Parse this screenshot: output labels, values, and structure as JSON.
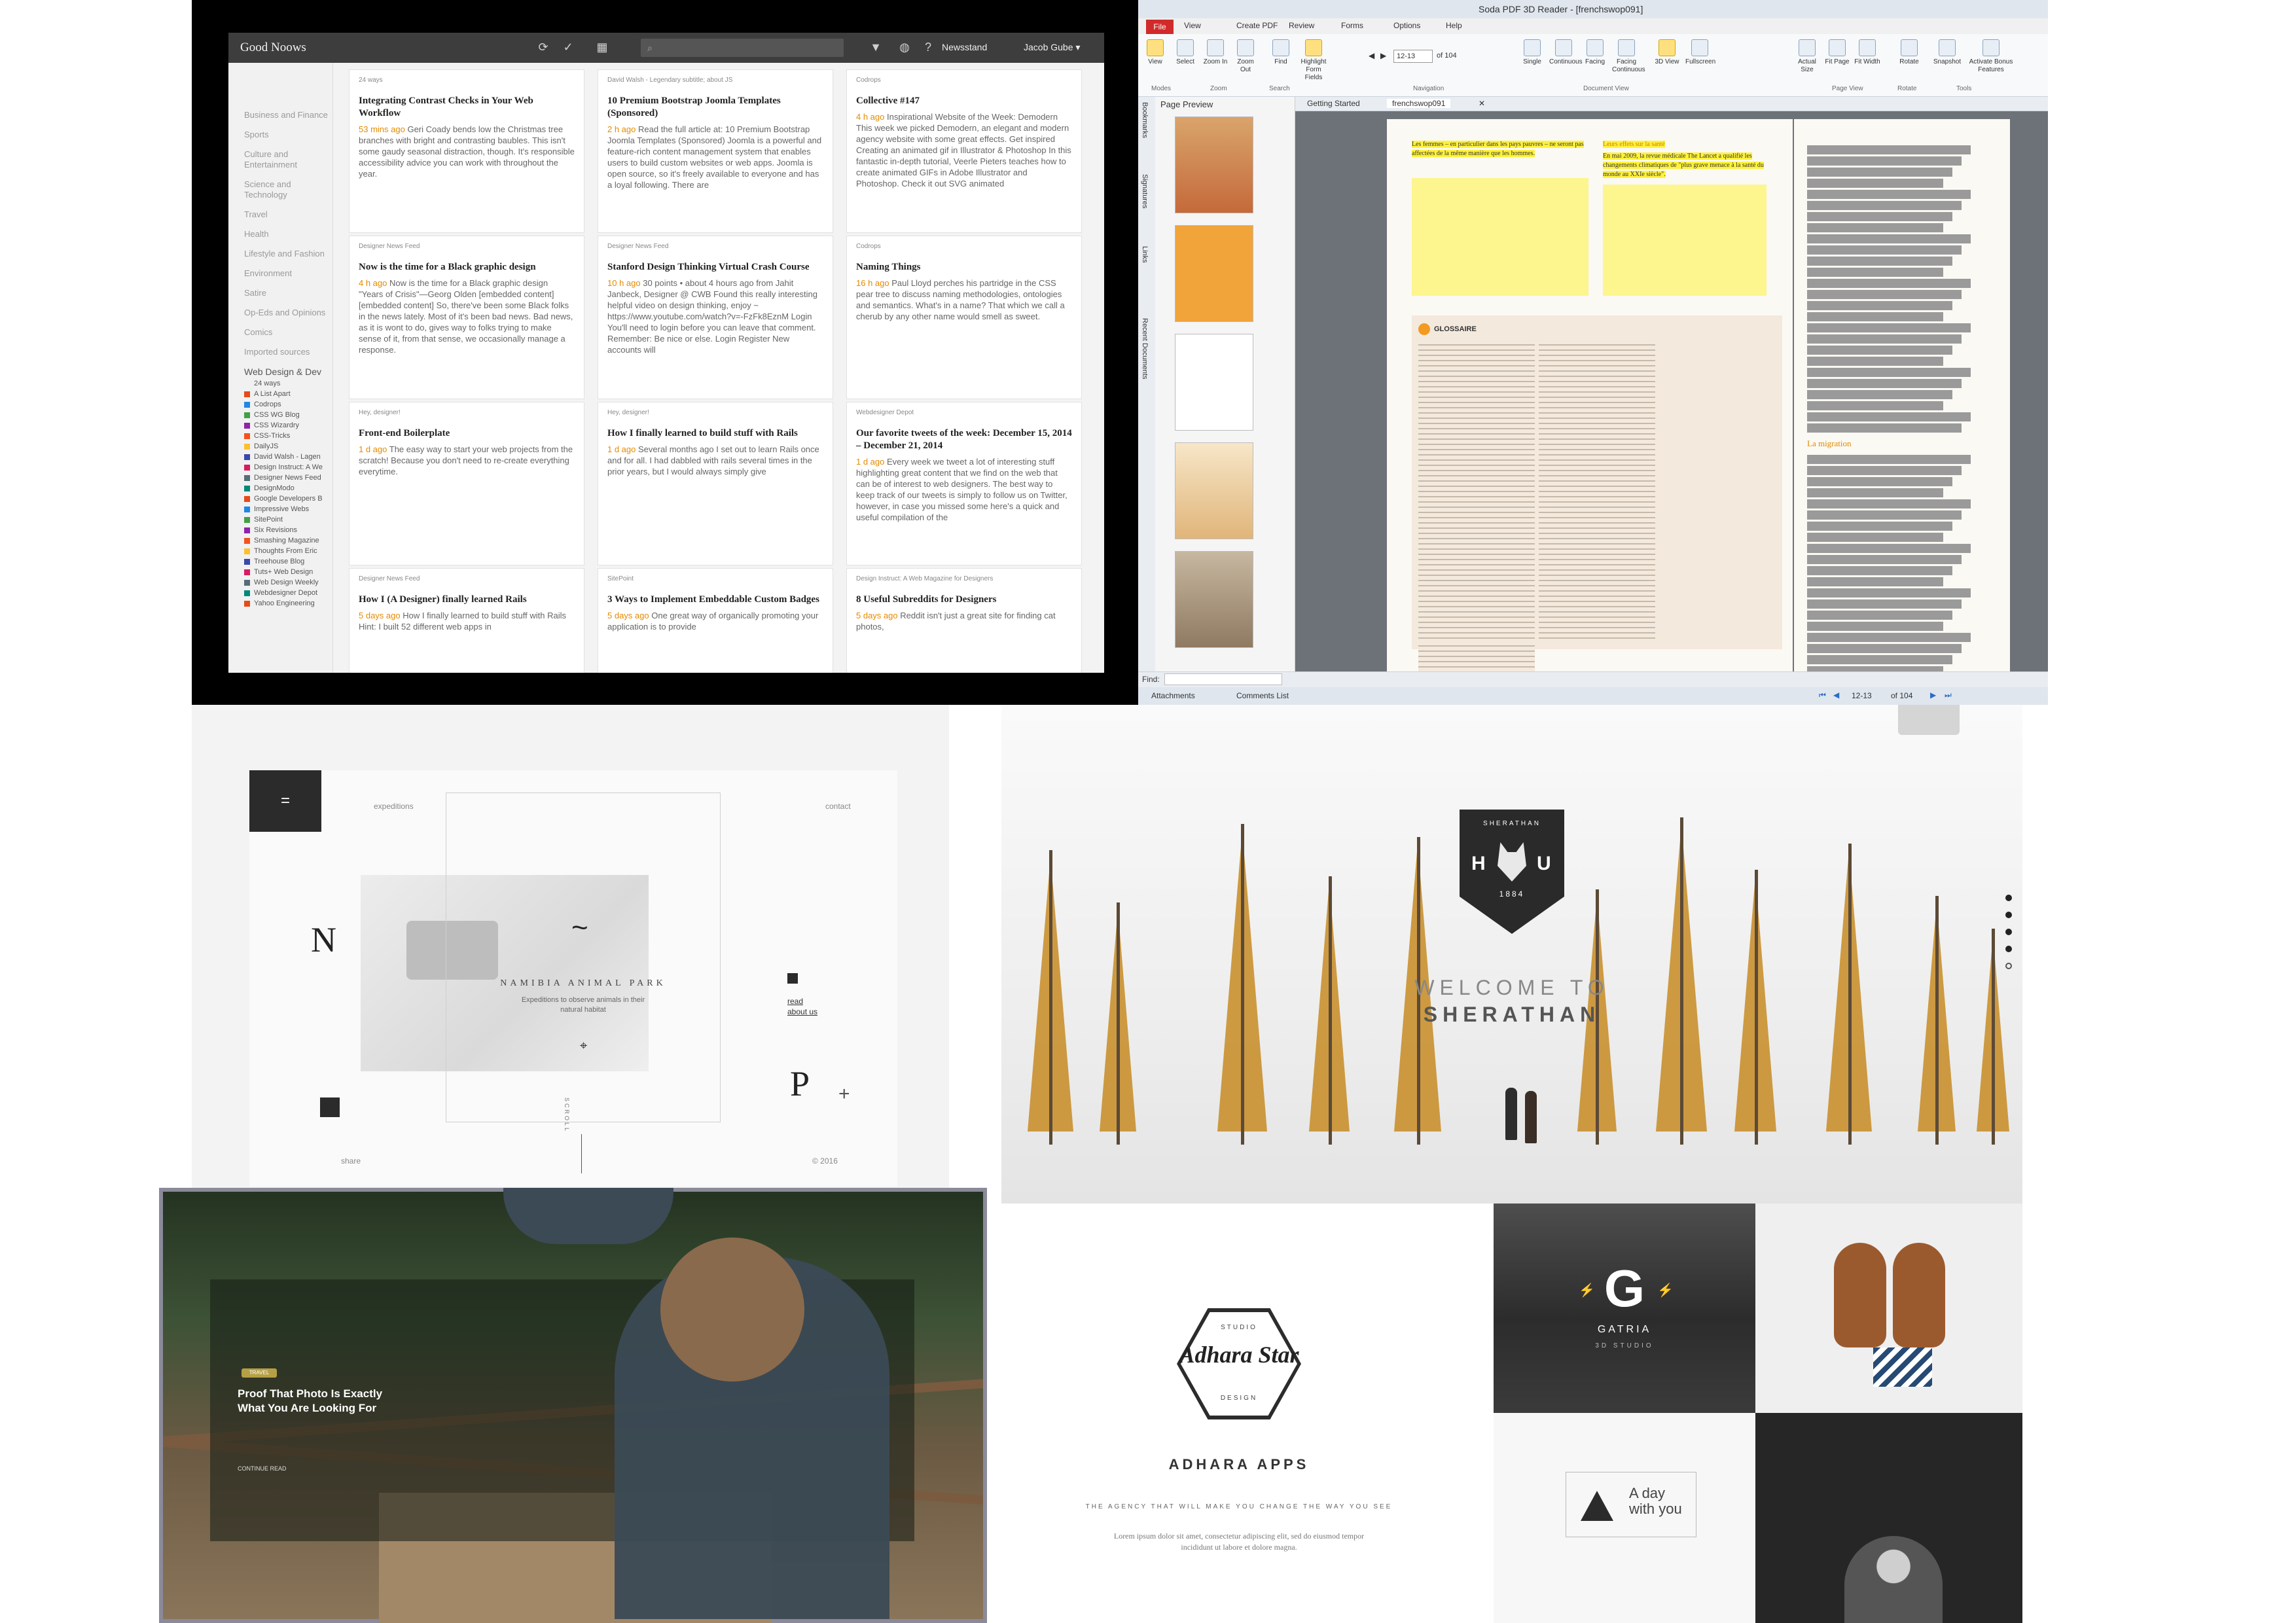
{
  "reader": {
    "title": "Good Noows",
    "newsstand": "Newsstand",
    "user": "Jacob Gube ▾",
    "categories": [
      "Business and Finance",
      "Sports",
      "Culture and Entertainment",
      "Science and Technology",
      "Travel",
      "Health",
      "Lifestyle and Fashion",
      "Environment",
      "Satire",
      "Op-Eds and Opinions",
      "Comics",
      "Imported sources"
    ],
    "section_head": "Web Design & Dev",
    "section_count": "24 ways",
    "sources": [
      "A List Apart",
      "Codrops",
      "CSS WG Blog",
      "CSS Wizardry",
      "CSS-Tricks",
      "DailyJS",
      "David Walsh - Lagen",
      "Design Instruct: A We",
      "Designer News Feed",
      "DesignModo",
      "Google Developers B",
      "Impressive Webs",
      "SitePoint",
      "Six Revisions",
      "Smashing Magazine",
      "Thoughts From Eric",
      "Treehouse Blog",
      "Tuts+ Web Design",
      "Web Design Weekly",
      "Webdesigner Depot",
      "Yahoo Engineering"
    ],
    "cards": [
      {
        "src": "24 ways",
        "title": "Integrating Contrast Checks in Your Web Workflow",
        "time": "53 mins ago",
        "body": "Geri Coady bends low the Christmas tree branches with bright and contrasting baubles. This isn't some gaudy seasonal distraction, though. It's responsible accessibility advice you can work with throughout the year."
      },
      {
        "src": "David Walsh - Legendary subtitle; about JS",
        "title": "10 Premium Bootstrap Joomla Templates (Sponsored)",
        "time": "2 h ago",
        "body": "Read the full article at: 10 Premium Bootstrap Joomla Templates (Sponsored) Joomla is a powerful and feature-rich content management system that enables users to build custom websites or web apps. Joomla is open source, so it's freely available to everyone and has a loyal following. There are"
      },
      {
        "src": "Codrops",
        "title": "Collective #147",
        "time": "4 h ago",
        "body": "Inspirational Website of the Week: Demodern This week we picked Demodern, an elegant and modern agency website with some great effects. Get inspired Creating an animated gif in Illustrator & Photoshop In this fantastic in-depth tutorial, Veerle Pieters teaches how to create animated GIFs in Adobe Illustrator and Photoshop. Check it out SVG animated"
      },
      {
        "src": "Designer News Feed",
        "title": "Now is the time for a Black graphic design",
        "time": "4 h ago",
        "body": "Now is the time for a Black graphic design \"Years of Crisis\"—Georg Olden [embedded content] [embedded content] So, there've been some Black folks in the news lately. Most of it's been bad news. Bad news, as it is wont to do, gives way to folks trying to make sense of it, from that sense, we occasionally manage a response."
      },
      {
        "src": "Designer News Feed",
        "title": "Stanford Design Thinking Virtual Crash Course",
        "time": "10 h ago",
        "body": "30 points • about 4 hours ago from Jahit Janbeck, Designer @ CWB Found this really interesting helpful video on design thinking, enjoy ~ https://www.youtube.com/watch?v=-FzFk8EznM Login You'll need to login before you can leave that comment. Remember: Be nice or else. Login Register New accounts will"
      },
      {
        "src": "Codrops",
        "title": "Naming Things",
        "time": "16 h ago",
        "body": "Paul Lloyd perches his partridge in the CSS pear tree to discuss naming methodologies, ontologies and semantics. What's in a name? That which we call a cherub by any other name would smell as sweet."
      },
      {
        "src": "Hey, designer!",
        "title": "Front-end Boilerplate",
        "time": "1 d ago",
        "body": "The easy way to start your web projects from the scratch! Because you don't need to re-create everything everytime."
      },
      {
        "src": "Hey, designer!",
        "title": "How I finally learned to build stuff with Rails",
        "time": "1 d ago",
        "body": "Several months ago I set out to learn Rails once and for all. I had dabbled with rails several times in the prior years, but I would always simply give"
      },
      {
        "src": "Webdesigner Depot",
        "title": "Our favorite tweets of the week: December 15, 2014 – December 21, 2014",
        "time": "1 d ago",
        "body": "Every week we tweet a lot of interesting stuff highlighting great content that we find on the web that can be of interest to web designers. The best way to keep track of our tweets is simply to follow us on Twitter, however, in case you missed some here's a quick and useful compilation of the"
      },
      {
        "src": "Designer News Feed",
        "title": "How I (A Designer) finally learned Rails",
        "time": "5 days ago",
        "body": "How I finally learned to build stuff with Rails Hint: I built 52 different web apps in"
      },
      {
        "src": "SitePoint",
        "title": "3 Ways to Implement Embeddable Custom Badges",
        "time": "5 days ago",
        "body": "One great way of organically promoting your application is to provide"
      },
      {
        "src": "Design Instruct: A Web Magazine for Designers",
        "title": "8 Useful Subreddits for Designers",
        "time": "5 days ago",
        "body": "Reddit isn't just a great site for finding cat photos,"
      }
    ],
    "colors": {
      "bar": "#3d3d3d",
      "accent": "#e68a00"
    }
  },
  "pdf": {
    "window_title": "Soda PDF 3D Reader - [frenchswop091]",
    "file_tab": "File",
    "tabs": [
      "View",
      "Create PDF",
      "Review",
      "Forms",
      "Options",
      "Help"
    ],
    "ribbon_buttons": [
      {
        "label": "View",
        "active": true
      },
      {
        "label": "Select",
        "active": false
      },
      {
        "label": "Zoom In",
        "active": false
      },
      {
        "label": "Zoom Out",
        "active": false
      },
      {
        "label": "Find",
        "active": false
      },
      {
        "label": "Highlight Form Fields",
        "active": true
      },
      {
        "label": "Single",
        "active": false
      },
      {
        "label": "Continuous",
        "active": false
      },
      {
        "label": "Facing",
        "active": false
      },
      {
        "label": "Facing Continuous",
        "active": false
      },
      {
        "label": "3D View",
        "active": true
      },
      {
        "label": "Fullscreen",
        "active": false
      },
      {
        "label": "Actual Size",
        "active": false
      },
      {
        "label": "Fit Page",
        "active": false
      },
      {
        "label": "Fit Width",
        "active": false
      },
      {
        "label": "Rotate",
        "active": false
      },
      {
        "label": "Snapshot",
        "active": false
      },
      {
        "label": "Activate Bonus Features",
        "active": false
      }
    ],
    "page_field": "12-13",
    "page_of": "of 104",
    "groups": [
      "Modes",
      "Zoom",
      "Search",
      "Navigation",
      "Document View",
      "Page View",
      "Rotate",
      "Tools"
    ],
    "preview_title": "Page Preview",
    "side_tabs": [
      "Bookmarks",
      "Signatures",
      "Links",
      "Recent Documents"
    ],
    "doc_tabs": [
      "Getting Started",
      "frenchswop091"
    ],
    "highlight_left": "Les femmes – en particulier dans les pays pauvres – ne seront pas affectées de la même manière que les hommes.",
    "highlight_right_head": "Leurs effets sur la santé",
    "highlight_right": "En mai 2009, la revue médicale The Lancet a qualifié les changements climatiques de \"plus grave menace à la santé du monde au XXIe siècle\".",
    "glossary_title": "GLOSSAIRE",
    "migration_head": "La migration",
    "findbar": "Find:",
    "status_tabs": [
      "Attachments",
      "Comments List"
    ],
    "status_page": "12-13",
    "status_of": "of 104"
  },
  "namibia": {
    "menu_icon": "=",
    "nav_expeditions": "expeditions",
    "nav_contact": "contact",
    "tilde": "~",
    "title": "NAMIBIA ANIMAL PARK",
    "subtitle": "Expeditions to observe animals in their natural habitat",
    "letter_left": "N",
    "letter_right": "P",
    "links": [
      "read",
      "about us"
    ],
    "share": "share",
    "year": "© 2016",
    "vertical": "SCROLL",
    "plus": "+"
  },
  "sherathan": {
    "badge_top": "SHERATHAN",
    "badge_left": "H",
    "badge_right": "U",
    "badge_year": "1884",
    "welcome": "WELCOME TO",
    "name": "SHERATHAN"
  },
  "bridge": {
    "pill": "TRAVEL",
    "title": "Proof That Photo Is Exactly What You Are Looking For",
    "cta": "CONTINUE READ"
  },
  "adhara": {
    "hex_top": "STUDIO",
    "logo": "Adhara Star",
    "hex_bottom": "DESIGN",
    "apps": "ADHARA APPS",
    "tagline": "THE AGENCY THAT WILL MAKE YOU CHANGE THE WAY YOU SEE",
    "para": "Lorem ipsum dolor sit amet, consectetur adipiscing elit, sed do eiusmod tempor incididunt ut labore et dolore magna.",
    "gatria_letter": "G",
    "gatria_name": "GATRIA",
    "gatria_sub": "3D STUDIO",
    "aday": "A day with you"
  }
}
